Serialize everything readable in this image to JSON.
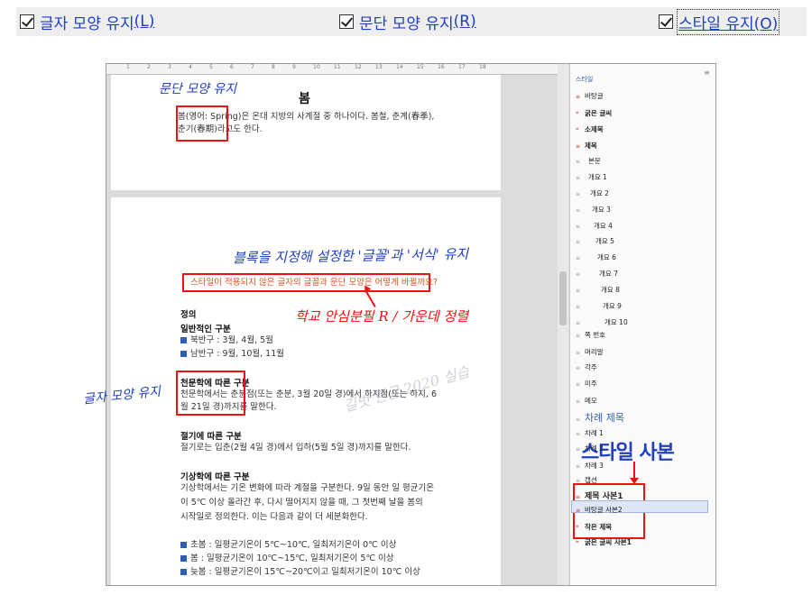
{
  "options": [
    {
      "label": "글자 모양 유지",
      "key": "(L)",
      "checked": true
    },
    {
      "label": "문단 모양 유지",
      "key": "(R)",
      "checked": true
    },
    {
      "label": "스타일 유지",
      "key": "(O)",
      "checked": true
    }
  ],
  "doc": {
    "title": "봄",
    "p1_line1": "봄(영어: Spring)은 온대 지방의 사계절 중 하나이다. 봄철, 춘계(春季),",
    "p1_line2": "춘기(春期)라고도 한다.",
    "sample_line": "스타일이 적용되지 않은 글자의 글꼴과 문단 모양은 어떻게 바뀔까요?",
    "definition": "정의",
    "common_head": "일반적인 구분",
    "north": "북반구 : 3월, 4월, 5월",
    "south": "남반구 : 9월, 10월, 11월",
    "astro_head": "천문학에 따른 구분",
    "astro_line1": "천문학에서는 춘분점(또는 춘분, 3월 20일 경)에서 하지점(또는 하지, 6",
    "astro_line2": "월 21일 경)까지를 말한다.",
    "season_head": "절기에 따른 구분",
    "season_line": "절기로는 입춘(2월 4일 경)에서 입하(5월 5일 경)까지를 말한다.",
    "weather_head": "기상학에 따른 구분",
    "weather_line1": "기상학에서는 기온 변화에 따라 계절을 구분한다. 9일 동안 일 평균기온",
    "weather_line2": "이 5℃ 이상 올라간 후, 다시 떨어지지 않을 때, 그 첫번째 날을 봄의",
    "weather_line3": "시작일로 정의한다. 이는 다음과 같이 더 세분화한다.",
    "early": "초봄 : 일평균기온이 5℃~10℃, 일최저기온이 0℃ 이상",
    "spring": "봄 : 일평균기온이 10℃~15℃, 일최저기온이 5℃ 이상",
    "late": "늦봄 : 일평균기온이 15℃~20℃이고 일최저기온이 10℃ 이상"
  },
  "annotations": {
    "para_keep": "문단 모양 유지",
    "block_keep": "블록을 지정해 설정한 '글꼴'과 '서식' 유지",
    "font_note": "학교 안심분필 R / 가운데 정렬",
    "char_keep": "글자 모양 유지",
    "style_copy": "스타일 사본",
    "watermark": "길벗 한글 2020 실습"
  },
  "ruler": [
    "1",
    "2",
    "3",
    "4",
    "5",
    "6",
    "7",
    "8",
    "9",
    "10",
    "11",
    "12",
    "13",
    "14",
    "15",
    "16",
    "17",
    "18"
  ],
  "styles_pane": {
    "title": "스타일",
    "items": [
      "바탕글",
      "굵은 글씨",
      "소제목",
      "제목",
      "본문",
      "개요 1",
      "개요 2",
      "개요 3",
      "개요 4",
      "개요 5",
      "개요 6",
      "개요 7",
      "개요 8",
      "개요 9",
      "개요 10",
      "쪽 번호",
      "머리말",
      "각주",
      "미주",
      "메모",
      "차례 제목",
      "차례 1",
      "차례 2",
      "차례 3",
      "캡션",
      "제목 사본1",
      "바탕글 사본2",
      "작은 제목",
      "굵은 글씨 사본1"
    ]
  },
  "colors": {
    "annotation_blue": "#1f3fbf",
    "annotation_red": "#e11111",
    "bullet": "#2f5fb3"
  }
}
